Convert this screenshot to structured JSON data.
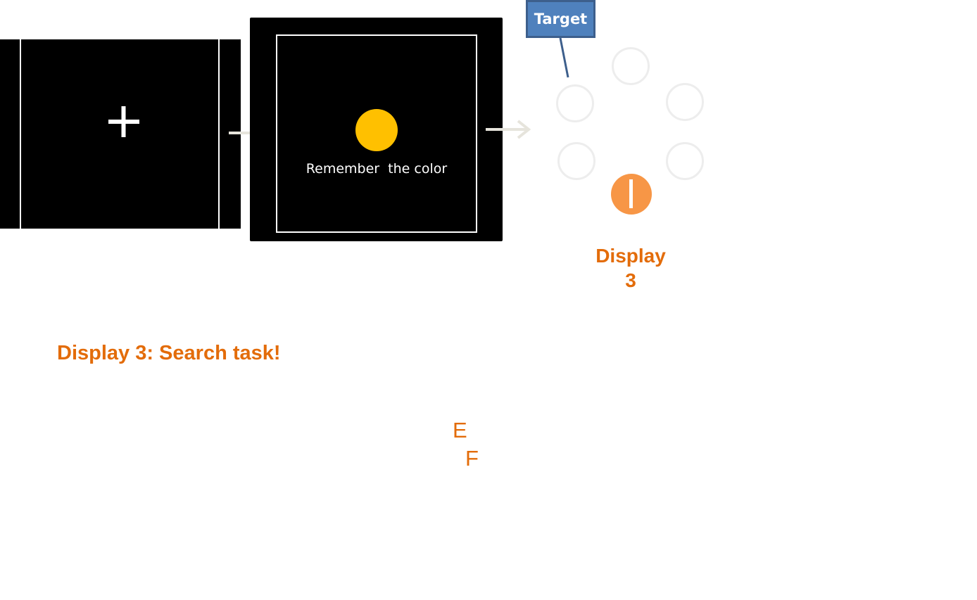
{
  "display1": {
    "fixation_symbol": "+"
  },
  "display2": {
    "instruction": "Remember  the color",
    "memory_color": "#ffc000"
  },
  "display3": {
    "target_label": "Target",
    "target_color": "#f79646",
    "caption_line1": "Display",
    "caption_line2": "3"
  },
  "section_title": "Display 3: Search task!",
  "letters": {
    "e": "E",
    "f": "F"
  },
  "colors": {
    "accent_orange": "#e36c0a",
    "callout_blue": "#4f81bd",
    "callout_border": "#3d5f8c",
    "arrow_gray": "#e6e4dc"
  },
  "icons": {
    "fixation": "plus-icon",
    "arrow": "right-arrow-icon"
  }
}
